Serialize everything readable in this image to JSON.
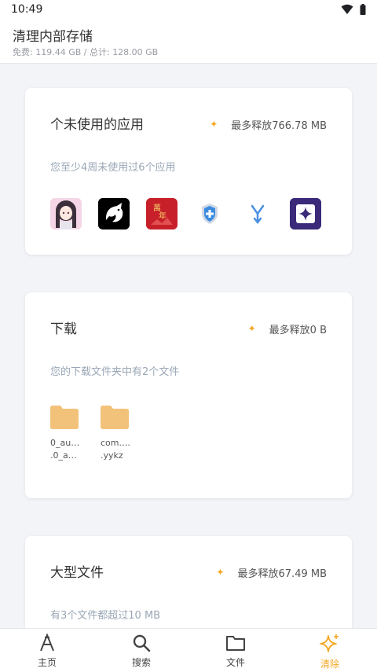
{
  "status_bar": {
    "time": "10:49"
  },
  "header": {
    "title": "清理内部存储",
    "storage": "免费: 119.44 GB / 总计: 128.00 GB"
  },
  "cards": {
    "unused_apps": {
      "title": "个未使用的应用",
      "save": "最多释放766.78 MB",
      "desc": "您至少4周未使用过6个应用",
      "apps": [
        {
          "icon": "anime-girl-app-icon"
        },
        {
          "icon": "dragon-app-icon"
        },
        {
          "icon": "calendar-app-icon"
        },
        {
          "icon": "shield-app-icon"
        },
        {
          "icon": "merge-arrow-app-icon"
        },
        {
          "icon": "sparkle-square-app-icon"
        }
      ]
    },
    "downloads": {
      "title": "下载",
      "save": "最多释放0 B",
      "desc": "您的下载文件夹中有2个文件",
      "files": [
        {
          "line1": "0_au…",
          "line2": ".0_a…"
        },
        {
          "line1": "com.…",
          "line2": ".yykz"
        }
      ]
    },
    "large_files": {
      "title": "大型文件",
      "save": "最多释放67.49 MB",
      "desc": "有3个文件都超过10 MB"
    }
  },
  "nav": [
    {
      "label": "主页",
      "icon": "home-icon"
    },
    {
      "label": "搜索",
      "icon": "search-icon"
    },
    {
      "label": "文件",
      "icon": "folder-icon"
    },
    {
      "label": "清除",
      "icon": "sparkle-icon",
      "active": true
    }
  ],
  "colors": {
    "accent": "#f5a623",
    "folder": "#f3c27a"
  }
}
